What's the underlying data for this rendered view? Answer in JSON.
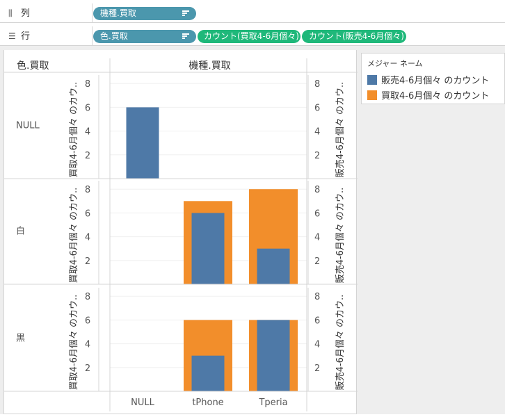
{
  "shelves": {
    "columns": {
      "label": "列",
      "icon": "columns-shelf-icon",
      "pills": [
        {
          "text": "機種.買取",
          "kind": "dimension",
          "sorted": true
        }
      ]
    },
    "rows": {
      "label": "行",
      "icon": "rows-shelf-icon",
      "pills": [
        {
          "text": "色.買取",
          "kind": "dimension",
          "sorted": true
        },
        {
          "text": "カウント(買取4-6月個々)",
          "kind": "measure",
          "sorted": false
        },
        {
          "text": "カウント(販売4-6月個々)",
          "kind": "measure",
          "sorted": false
        }
      ]
    }
  },
  "chart_data": {
    "type": "bar",
    "row_header_title": "色.買取",
    "column_header_title": "機種.買取",
    "categories": [
      "NULL",
      "tPhone",
      "Tperia"
    ],
    "rows": [
      "NULL",
      "白",
      "黒"
    ],
    "left_axis_label": "買取4-6月個々 のカウ..",
    "right_axis_label": "販売4-6月個々 のカウ..",
    "y_ticks": [
      2,
      4,
      6,
      8
    ],
    "ylim": [
      0,
      9
    ],
    "series": [
      {
        "name": "販売4-6月個々 のカウント",
        "color": "#4e79a7",
        "values": [
          [
            6,
            null,
            null
          ],
          [
            null,
            6,
            3
          ],
          [
            null,
            3,
            6
          ]
        ]
      },
      {
        "name": "買取4-6月個々 のカウント",
        "color": "#f28e2b",
        "values": [
          [
            null,
            null,
            null
          ],
          [
            null,
            7,
            8
          ],
          [
            null,
            6,
            6
          ]
        ]
      }
    ],
    "legend": {
      "title": "メジャー ネーム",
      "position": "right"
    },
    "grid": true
  }
}
